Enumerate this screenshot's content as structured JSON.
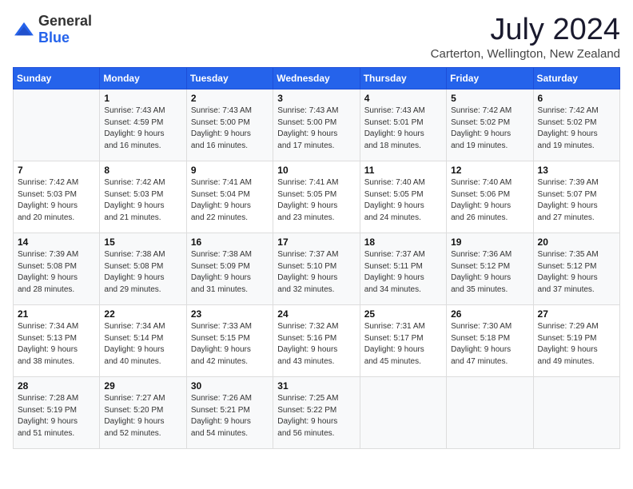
{
  "header": {
    "logo_general": "General",
    "logo_blue": "Blue",
    "title": "July 2024",
    "subtitle": "Carterton, Wellington, New Zealand"
  },
  "calendar": {
    "days_of_week": [
      "Sunday",
      "Monday",
      "Tuesday",
      "Wednesday",
      "Thursday",
      "Friday",
      "Saturday"
    ],
    "weeks": [
      [
        {
          "day": "",
          "info": ""
        },
        {
          "day": "1",
          "info": "Sunrise: 7:43 AM\nSunset: 4:59 PM\nDaylight: 9 hours\nand 16 minutes."
        },
        {
          "day": "2",
          "info": "Sunrise: 7:43 AM\nSunset: 5:00 PM\nDaylight: 9 hours\nand 16 minutes."
        },
        {
          "day": "3",
          "info": "Sunrise: 7:43 AM\nSunset: 5:00 PM\nDaylight: 9 hours\nand 17 minutes."
        },
        {
          "day": "4",
          "info": "Sunrise: 7:43 AM\nSunset: 5:01 PM\nDaylight: 9 hours\nand 18 minutes."
        },
        {
          "day": "5",
          "info": "Sunrise: 7:42 AM\nSunset: 5:02 PM\nDaylight: 9 hours\nand 19 minutes."
        },
        {
          "day": "6",
          "info": "Sunrise: 7:42 AM\nSunset: 5:02 PM\nDaylight: 9 hours\nand 19 minutes."
        }
      ],
      [
        {
          "day": "7",
          "info": "Sunrise: 7:42 AM\nSunset: 5:03 PM\nDaylight: 9 hours\nand 20 minutes."
        },
        {
          "day": "8",
          "info": "Sunrise: 7:42 AM\nSunset: 5:03 PM\nDaylight: 9 hours\nand 21 minutes."
        },
        {
          "day": "9",
          "info": "Sunrise: 7:41 AM\nSunset: 5:04 PM\nDaylight: 9 hours\nand 22 minutes."
        },
        {
          "day": "10",
          "info": "Sunrise: 7:41 AM\nSunset: 5:05 PM\nDaylight: 9 hours\nand 23 minutes."
        },
        {
          "day": "11",
          "info": "Sunrise: 7:40 AM\nSunset: 5:05 PM\nDaylight: 9 hours\nand 24 minutes."
        },
        {
          "day": "12",
          "info": "Sunrise: 7:40 AM\nSunset: 5:06 PM\nDaylight: 9 hours\nand 26 minutes."
        },
        {
          "day": "13",
          "info": "Sunrise: 7:39 AM\nSunset: 5:07 PM\nDaylight: 9 hours\nand 27 minutes."
        }
      ],
      [
        {
          "day": "14",
          "info": "Sunrise: 7:39 AM\nSunset: 5:08 PM\nDaylight: 9 hours\nand 28 minutes."
        },
        {
          "day": "15",
          "info": "Sunrise: 7:38 AM\nSunset: 5:08 PM\nDaylight: 9 hours\nand 29 minutes."
        },
        {
          "day": "16",
          "info": "Sunrise: 7:38 AM\nSunset: 5:09 PM\nDaylight: 9 hours\nand 31 minutes."
        },
        {
          "day": "17",
          "info": "Sunrise: 7:37 AM\nSunset: 5:10 PM\nDaylight: 9 hours\nand 32 minutes."
        },
        {
          "day": "18",
          "info": "Sunrise: 7:37 AM\nSunset: 5:11 PM\nDaylight: 9 hours\nand 34 minutes."
        },
        {
          "day": "19",
          "info": "Sunrise: 7:36 AM\nSunset: 5:12 PM\nDaylight: 9 hours\nand 35 minutes."
        },
        {
          "day": "20",
          "info": "Sunrise: 7:35 AM\nSunset: 5:12 PM\nDaylight: 9 hours\nand 37 minutes."
        }
      ],
      [
        {
          "day": "21",
          "info": "Sunrise: 7:34 AM\nSunset: 5:13 PM\nDaylight: 9 hours\nand 38 minutes."
        },
        {
          "day": "22",
          "info": "Sunrise: 7:34 AM\nSunset: 5:14 PM\nDaylight: 9 hours\nand 40 minutes."
        },
        {
          "day": "23",
          "info": "Sunrise: 7:33 AM\nSunset: 5:15 PM\nDaylight: 9 hours\nand 42 minutes."
        },
        {
          "day": "24",
          "info": "Sunrise: 7:32 AM\nSunset: 5:16 PM\nDaylight: 9 hours\nand 43 minutes."
        },
        {
          "day": "25",
          "info": "Sunrise: 7:31 AM\nSunset: 5:17 PM\nDaylight: 9 hours\nand 45 minutes."
        },
        {
          "day": "26",
          "info": "Sunrise: 7:30 AM\nSunset: 5:18 PM\nDaylight: 9 hours\nand 47 minutes."
        },
        {
          "day": "27",
          "info": "Sunrise: 7:29 AM\nSunset: 5:19 PM\nDaylight: 9 hours\nand 49 minutes."
        }
      ],
      [
        {
          "day": "28",
          "info": "Sunrise: 7:28 AM\nSunset: 5:19 PM\nDaylight: 9 hours\nand 51 minutes."
        },
        {
          "day": "29",
          "info": "Sunrise: 7:27 AM\nSunset: 5:20 PM\nDaylight: 9 hours\nand 52 minutes."
        },
        {
          "day": "30",
          "info": "Sunrise: 7:26 AM\nSunset: 5:21 PM\nDaylight: 9 hours\nand 54 minutes."
        },
        {
          "day": "31",
          "info": "Sunrise: 7:25 AM\nSunset: 5:22 PM\nDaylight: 9 hours\nand 56 minutes."
        },
        {
          "day": "",
          "info": ""
        },
        {
          "day": "",
          "info": ""
        },
        {
          "day": "",
          "info": ""
        }
      ]
    ]
  }
}
